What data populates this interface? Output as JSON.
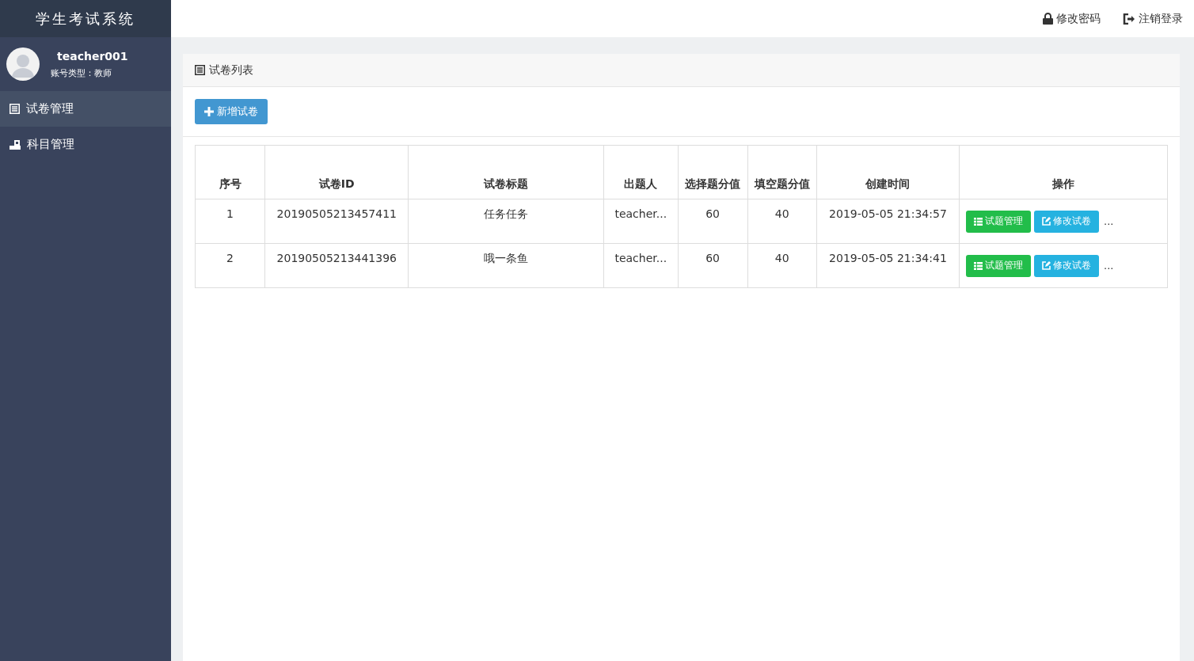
{
  "app_title": "学生考试系统",
  "user": {
    "name": "teacher001",
    "role": "账号类型：教师"
  },
  "sidebar": {
    "items": [
      {
        "label": "试卷管理",
        "kind": "list",
        "selected": true
      },
      {
        "label": "科目管理",
        "kind": "desk",
        "selected": false
      }
    ]
  },
  "topbar": {
    "links": [
      {
        "label": "修改密码",
        "kind": "password"
      },
      {
        "label": "注销登录",
        "kind": "logout"
      }
    ]
  },
  "panel": {
    "title": "试卷列表",
    "add_button": "新增试卷"
  },
  "table": {
    "columns": [
      "序号",
      "试卷ID",
      "试卷标题",
      "出题人",
      "选择题分值",
      "填空题分值",
      "创建时间",
      "操作"
    ],
    "rows": [
      {
        "cells": [
          "1",
          "20190505213457411",
          "任务任务",
          "teacher...",
          "60",
          "40",
          "2019-05-05 21:34:57"
        ],
        "actions": [
          {
            "kind": "questions",
            "label": "试题管理"
          },
          {
            "kind": "edit",
            "label": "修改试卷"
          }
        ],
        "more": "..."
      },
      {
        "cells": [
          "2",
          "20190505213441396",
          "哦一条鱼",
          "teacher...",
          "60",
          "40",
          "2019-05-05 21:34:41"
        ],
        "actions": [
          {
            "kind": "questions",
            "label": "试题管理"
          },
          {
            "kind": "edit",
            "label": "修改试卷"
          }
        ],
        "more": "..."
      }
    ]
  }
}
